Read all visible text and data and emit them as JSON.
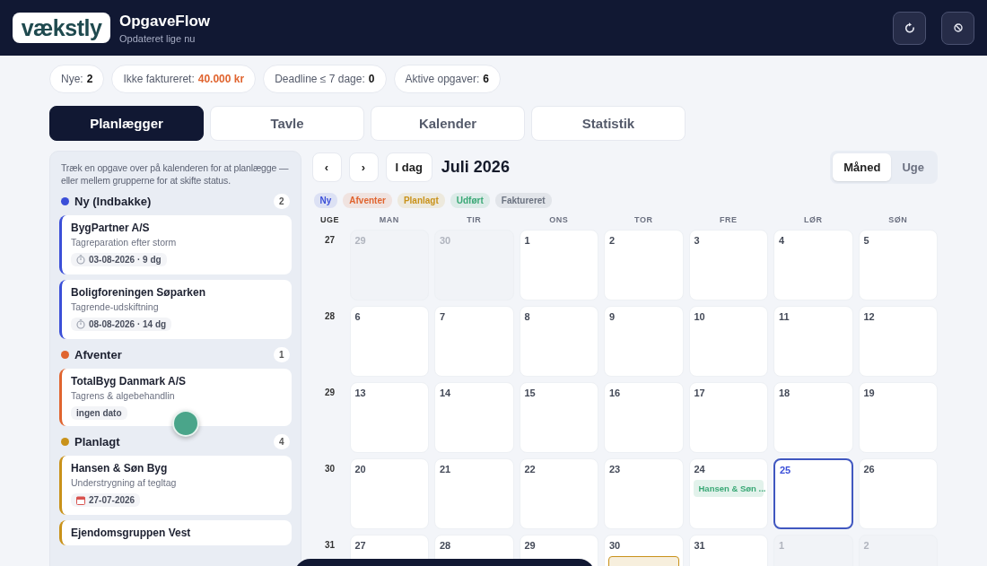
{
  "header": {
    "logo": "vækstly",
    "title": "OpgaveFlow",
    "subtitle": "Opdateret lige nu"
  },
  "stats": [
    {
      "label": "Nye:",
      "value": "2",
      "kind": "count"
    },
    {
      "label": "Ikke faktureret:",
      "value": "40.000 kr",
      "kind": "money"
    },
    {
      "label": "Deadline ≤ 7 dage:",
      "value": "0",
      "kind": "count"
    },
    {
      "label": "Aktive opgaver:",
      "value": "6",
      "kind": "count"
    }
  ],
  "tabs": [
    {
      "label": "Planlægger",
      "selected": true
    },
    {
      "label": "Tavle",
      "selected": false
    },
    {
      "label": "Kalender",
      "selected": false
    },
    {
      "label": "Statistik",
      "selected": false
    }
  ],
  "sidebar": {
    "hint": "Træk en opgave over på kalenderen for at planlægge — eller mellem grupperne for at skifte status.",
    "groups": [
      {
        "name": "Ny (Indbakke)",
        "color": "#3b4fd8",
        "count": "2",
        "tasks": [
          {
            "client": "BygPartner A/S",
            "title": "Tagreparation efter storm",
            "due": {
              "kind": "deadline",
              "text": "03-08-2026 · 9 dg"
            }
          },
          {
            "client": "Boligforeningen Søparken",
            "title": "Tagrende-udskiftning",
            "due": {
              "kind": "deadline",
              "text": "08-08-2026 · 14 dg"
            }
          }
        ]
      },
      {
        "name": "Afventer",
        "color": "#e0642f",
        "count": "1",
        "tasks": [
          {
            "client": "TotalByg Danmark A/S",
            "title": "Tagrens & algebehandlin",
            "due": {
              "kind": "none",
              "text": "ingen dato"
            }
          }
        ]
      },
      {
        "name": "Planlagt",
        "color": "#c9921a",
        "count": "4",
        "tasks": [
          {
            "client": "Hansen & Søn Byg",
            "title": "Understrygning af tegltag",
            "due": {
              "kind": "planned",
              "text": "27-07-2026"
            }
          },
          {
            "client": "Ejendomsgruppen Vest"
          }
        ]
      }
    ]
  },
  "calendar": {
    "prev": "‹",
    "next": "›",
    "today_button": "I dag",
    "month": "Juli 2026",
    "views": [
      {
        "label": "Måned",
        "selected": true
      },
      {
        "label": "Uge",
        "selected": false
      }
    ],
    "legend": [
      {
        "label": "Ny",
        "color": "#3b4fd8"
      },
      {
        "label": "Afventer",
        "color": "#e0642f"
      },
      {
        "label": "Planlagt",
        "color": "#c9921a"
      },
      {
        "label": "Udført",
        "color": "#3aa876"
      },
      {
        "label": "Faktureret",
        "color": "#6b7280"
      }
    ],
    "week_header": "UGE",
    "weekdays": [
      "MAN",
      "TIR",
      "ONS",
      "TOR",
      "FRE",
      "LØR",
      "SØN"
    ],
    "weeks": [
      {
        "number": "27",
        "days": [
          {
            "day": "29",
            "outside": true,
            "today": false
          },
          {
            "day": "30",
            "outside": true,
            "today": false
          },
          {
            "day": "1",
            "outside": false,
            "today": false
          },
          {
            "day": "2",
            "outside": false,
            "today": false
          },
          {
            "day": "3",
            "outside": false,
            "today": false
          },
          {
            "day": "4",
            "outside": false,
            "today": false
          },
          {
            "day": "5",
            "outside": false,
            "today": false
          }
        ]
      },
      {
        "number": "28",
        "days": [
          {
            "day": "6",
            "outside": false,
            "today": false
          },
          {
            "day": "7",
            "outside": false,
            "today": false
          },
          {
            "day": "8",
            "outside": false,
            "today": false
          },
          {
            "day": "9",
            "outside": false,
            "today": false
          },
          {
            "day": "10",
            "outside": false,
            "today": false
          },
          {
            "day": "11",
            "outside": false,
            "today": false
          },
          {
            "day": "12",
            "outside": false,
            "today": false
          }
        ]
      },
      {
        "number": "29",
        "days": [
          {
            "day": "13",
            "outside": false,
            "today": false
          },
          {
            "day": "14",
            "outside": false,
            "today": false
          },
          {
            "day": "15",
            "outside": false,
            "today": false
          },
          {
            "day": "16",
            "outside": false,
            "today": false
          },
          {
            "day": "17",
            "outside": false,
            "today": false
          },
          {
            "day": "18",
            "outside": false,
            "today": false
          },
          {
            "day": "19",
            "outside": false,
            "today": false
          }
        ]
      },
      {
        "number": "30",
        "days": [
          {
            "day": "20",
            "outside": false,
            "today": false
          },
          {
            "day": "21",
            "outside": false,
            "today": false
          },
          {
            "day": "22",
            "outside": false,
            "today": false
          },
          {
            "day": "23",
            "outside": false,
            "today": false
          },
          {
            "day": "24",
            "outside": false,
            "today": false,
            "events": [
              {
                "label": "Hansen & Søn ...",
                "color": "#3aa876"
              }
            ]
          },
          {
            "day": "25",
            "outside": false,
            "today": true
          },
          {
            "day": "26",
            "outside": false,
            "today": false
          }
        ]
      },
      {
        "number": "31",
        "days": [
          {
            "day": "27",
            "outside": false,
            "today": false
          },
          {
            "day": "28",
            "outside": false,
            "today": false
          },
          {
            "day": "29",
            "outside": false,
            "today": false
          },
          {
            "day": "30",
            "outside": false,
            "today": false,
            "events": [
              {
                "color": "#c9921a"
              }
            ]
          },
          {
            "day": "31",
            "outside": false,
            "today": false
          },
          {
            "day": "1",
            "outside": true,
            "today": false
          },
          {
            "day": "2",
            "outside": true,
            "today": false
          }
        ]
      }
    ]
  }
}
